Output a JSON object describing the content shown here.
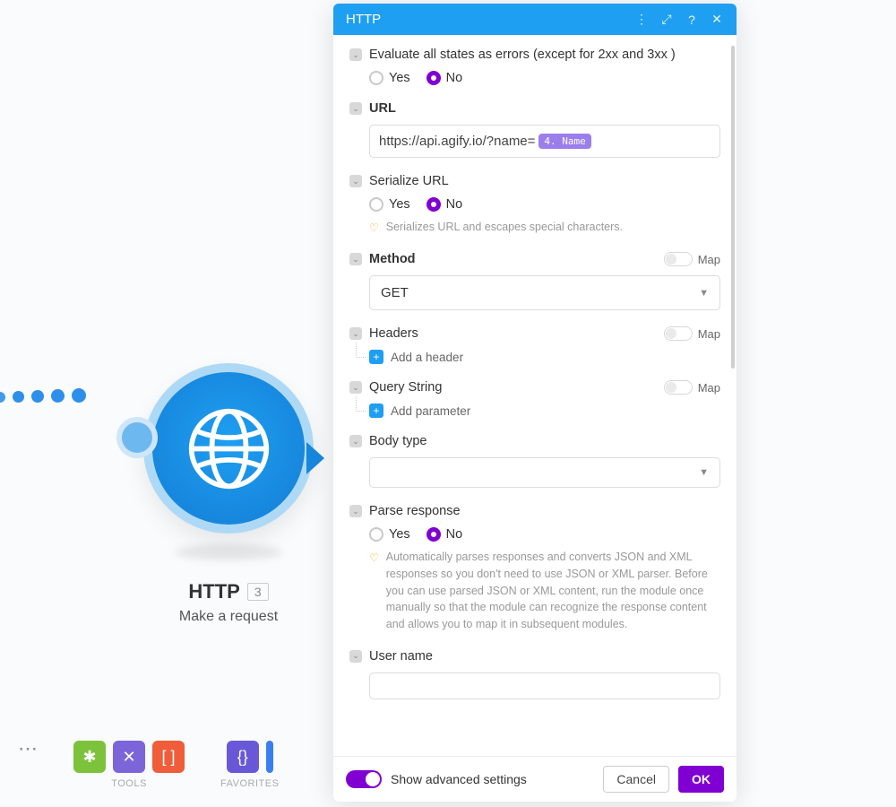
{
  "node": {
    "title": "HTTP",
    "badge": "3",
    "subtitle": "Make a request"
  },
  "panel": {
    "title": "HTTP",
    "evaluate": {
      "label": "Evaluate all states as errors (except for 2xx and 3xx )",
      "yes": "Yes",
      "no": "No"
    },
    "url": {
      "label": "URL",
      "value": "https://api.agify.io/?name=",
      "pill": "4. Name"
    },
    "serialize": {
      "label": "Serialize URL",
      "yes": "Yes",
      "no": "No",
      "hint": "Serializes URL and escapes special characters."
    },
    "method": {
      "label": "Method",
      "value": "GET",
      "map": "Map"
    },
    "headers": {
      "label": "Headers",
      "add": "Add a header",
      "map": "Map"
    },
    "query": {
      "label": "Query String",
      "add": "Add parameter",
      "map": "Map"
    },
    "body": {
      "label": "Body type"
    },
    "parse": {
      "label": "Parse response",
      "yes": "Yes",
      "no": "No",
      "hint": "Automatically parses responses and converts JSON and XML responses so you don't need to use JSON or XML parser. Before you can use parsed JSON or XML content, run the module once manually so that the module can recognize the response content and allows you to map it in subsequent modules."
    },
    "username": {
      "label": "User name"
    },
    "footer": {
      "advanced": "Show advanced settings",
      "cancel": "Cancel",
      "ok": "OK"
    }
  },
  "toolbar": {
    "tools": "TOOLS",
    "favorites": "FAVORITES"
  }
}
